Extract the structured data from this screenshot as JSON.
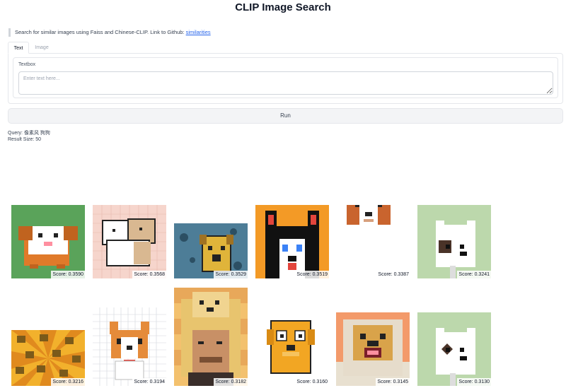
{
  "page": {
    "title": "CLIP Image Search"
  },
  "description": {
    "text": "Search for similar images using Faiss and Chinese-CLIP. Link to Github: ",
    "link_text": "similarities"
  },
  "tabs": [
    {
      "label": "Text"
    },
    {
      "label": "Image"
    }
  ],
  "textbox": {
    "label": "Textbox",
    "placeholder": "Enter text here..."
  },
  "run_button": {
    "label": "Run"
  },
  "results_info": {
    "query_text": "Query: 像素风 狗狗",
    "result_size_text": "Result Size: 50"
  },
  "results": [
    {
      "score": "Score: 0.3590",
      "icon": "pixel-guinea-pig"
    },
    {
      "score": "Score: 0.3568",
      "icon": "pixel-dogs-hugging"
    },
    {
      "score": "Score: 0.3529",
      "icon": "pixel-dog-night"
    },
    {
      "score": "Score: 0.3519",
      "icon": "pixel-husky-orange"
    },
    {
      "score": "Score: 0.3387",
      "icon": "pixel-akita"
    },
    {
      "score": "Score: 0.3241",
      "icon": "pixel-white-dog-green"
    },
    {
      "score": "Score: 0.3216",
      "icon": "pixel-dogs-sunburst"
    },
    {
      "score": "Score: 0.3194",
      "icon": "pixel-corgi"
    },
    {
      "score": "Score: 0.3182",
      "icon": "pixel-doge-hat"
    },
    {
      "score": "Score: 0.3160",
      "icon": "pixel-jake-dog"
    },
    {
      "score": "Score: 0.3145",
      "icon": "pixel-shiba-scarf"
    },
    {
      "score": "Score: 0.3130",
      "icon": "pixel-white-dog-green"
    }
  ]
}
